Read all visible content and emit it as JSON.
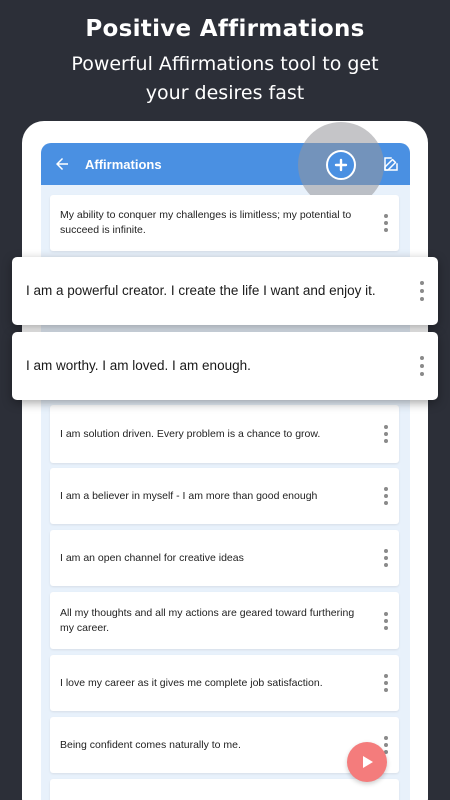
{
  "promo": {
    "title": "Positive Affirmations",
    "subtitle": "Powerful Affirmations tool to get your desires fast"
  },
  "appbar": {
    "title": "Affirmations"
  },
  "highlighted": [
    "I am a powerful creator. I create the life I want and enjoy it.",
    "I am worthy. I am loved. I am enough."
  ],
  "affirmations": [
    "My ability to conquer my challenges is limitless; my potential to succeed is infinite.",
    "I am solution driven. Every problem is a chance to grow.",
    "I am a believer in myself - I am more than good enough",
    "I am an open channel for creative ideas",
    "All my thoughts and all my actions are geared toward furthering my career.",
    "I love my career as it gives me complete job satisfaction.",
    "Being confident comes naturally to me."
  ],
  "colors": {
    "background": "#2c2f38",
    "appbar": "#4a90e2",
    "list_bg": "#e8f1fb",
    "play_button": "#f47c7c"
  },
  "icons": {
    "back": "arrow-left-icon",
    "add": "plus-circle-icon",
    "edit": "edit-icon",
    "more": "more-vertical-icon",
    "play": "play-icon"
  }
}
